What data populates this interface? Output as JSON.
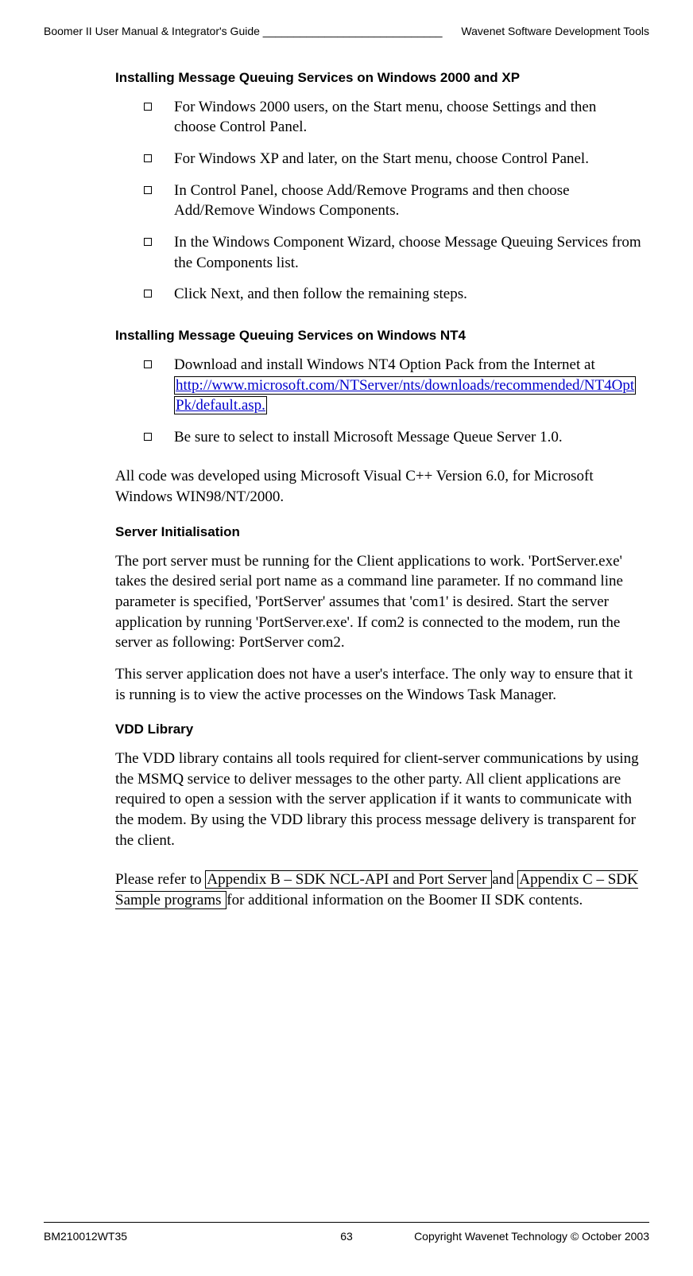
{
  "header": {
    "left": "Boomer II User Manual & Integrator's Guide _____________________________",
    "right": "Wavenet Software Development Tools"
  },
  "sections": {
    "s1_title": "Installing Message Queuing Services on Windows 2000 and XP",
    "s1_items": [
      "For Windows 2000 users, on the Start menu, choose Settings and then choose Control Panel.",
      "For Windows XP and later, on the Start menu, choose Control Panel.",
      "In Control Panel, choose Add/Remove Programs and then choose Add/Remove Windows Components.",
      "In the Windows Component Wizard, choose Message Queuing Services from the Components list.",
      "Click Next, and then follow the remaining steps."
    ],
    "s2_title": "Installing Message Queuing Services on Windows NT4",
    "s2_item1_prefix": "Download and install Windows NT4 Option Pack from the Internet at",
    "s2_link1": "http://www.microsoft.com/NTServer/nts/downloads/recommended/NT4Opt",
    "s2_link2": "Pk/default.asp.",
    "s2_item2": "Be sure to select to install Microsoft Message Queue Server 1.0.",
    "para1": "All code was developed using Microsoft Visual C++ Version 6.0, for Microsoft Windows WIN98/NT/2000.",
    "s3_title": "Server Initialisation",
    "s3_p1": "The port server must be running for the Client applications to work. 'PortServer.exe' takes the desired serial port name as a command line parameter. If no command line parameter is specified, 'PortServer' assumes that 'com1' is desired. Start the server application by running 'PortServer.exe'. If com2 is connected to the modem, run the server as following: PortServer com2.",
    "s3_p2": "This server application does not have a user's interface. The only way to ensure that it is running is to view the active processes on the Windows Task Manager.",
    "s4_title": "VDD Library",
    "s4_p1": "The VDD library contains all tools required for client-server communications by using the MSMQ service to deliver messages to the other party. All client applications are required to open a session with the server application if it wants to communicate with the modem. By using the VDD library this process message delivery is transparent for the client.",
    "appendix_prefix": "Please refer to ",
    "appendix_b": "Appendix B – SDK NCL-API and Port Server ",
    "appendix_mid": "and ",
    "appendix_c": "Appendix C – SDK Sample programs ",
    "appendix_suffix": "for additional information on the Boomer II SDK contents."
  },
  "footer": {
    "left": "BM210012WT35",
    "center": "63",
    "right": "Copyright Wavenet Technology © October 2003"
  }
}
